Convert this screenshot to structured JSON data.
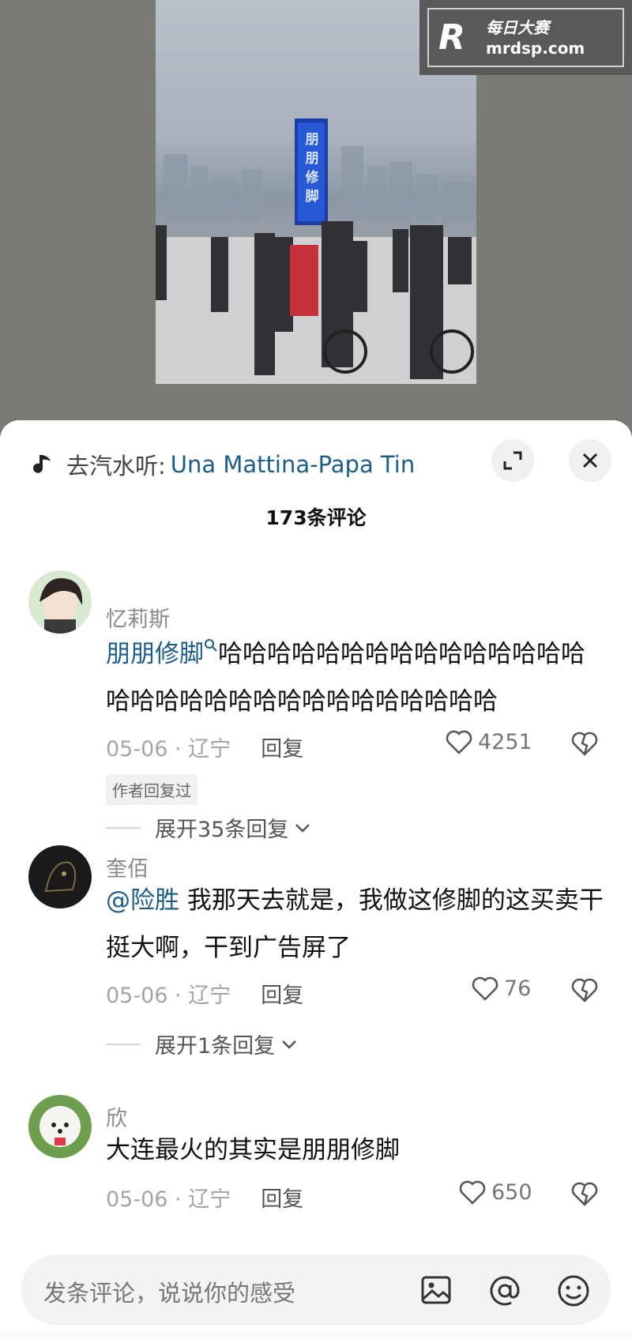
{
  "watermark": {
    "logo": "R",
    "cn": "每日大赛",
    "en": "mrdsp.com"
  },
  "video": {
    "tower_text": [
      "朋",
      "朋",
      "修",
      "脚"
    ]
  },
  "music": {
    "prefix": "去汽水听:",
    "title": "Una Mattina-Papa Tin",
    "icon": "music-note-icon"
  },
  "header": {
    "count_title": "173条评论"
  },
  "comments": [
    {
      "name": "忆莉斯",
      "link": "朋朋修脚",
      "text": "哈哈哈哈哈哈哈哈哈哈哈哈哈哈哈哈哈哈哈哈哈哈哈哈哈哈哈哈哈哈哈",
      "date": "05-06 · 辽宁",
      "reply": "回复",
      "likes": "4251",
      "badge": "作者回复过",
      "expand": "展开35条回复"
    },
    {
      "name": "奎佰",
      "link": "@险胜",
      "text": " 我那天去就是，我做这修脚的这买卖干挺大啊，干到广告屏了",
      "date": "05-06 · 辽宁",
      "reply": "回复",
      "likes": "76",
      "expand": "展开1条回复"
    },
    {
      "name": "欣",
      "text": "大连最火的其实是朋朋修脚",
      "date": "05-06 · 辽宁",
      "reply": "回复",
      "likes": "650"
    }
  ],
  "input": {
    "placeholder": "发条评论，说说你的感受"
  },
  "colors": {
    "link": "#1d5d86",
    "sheet_bg": "#ffffff",
    "page_bg": "#7a7a74"
  }
}
